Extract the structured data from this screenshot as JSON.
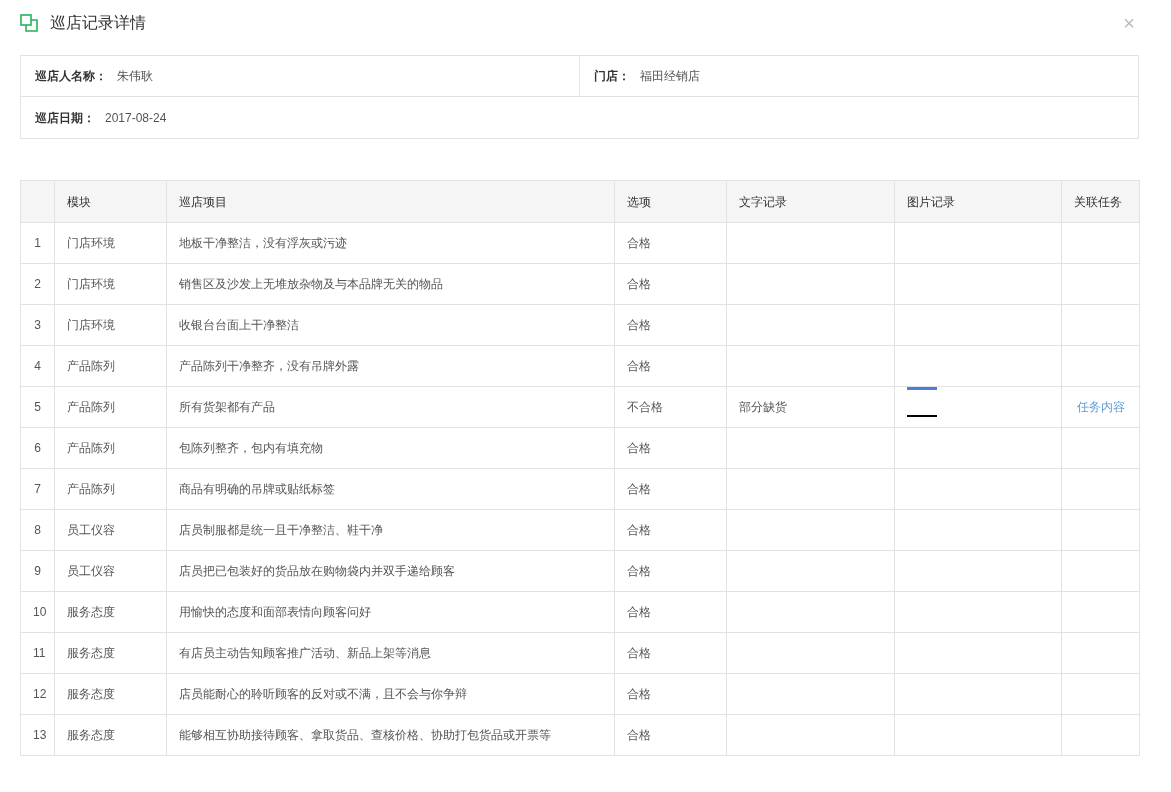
{
  "dialog": {
    "title": "巡店记录详情",
    "close": "×"
  },
  "info": [
    {
      "label": "巡店人名称：",
      "value": "朱伟耿"
    },
    {
      "label": "门店：",
      "value": "福田经销店"
    },
    {
      "label": "巡店日期：",
      "value": "2017-08-24"
    }
  ],
  "table": {
    "columns": [
      "",
      "模块",
      "巡店项目",
      "选项",
      "文字记录",
      "图片记录",
      "关联任务"
    ],
    "rows": [
      {
        "index": "1",
        "module": "门店环境",
        "item": "地板干净整洁，没有浮灰或污迹",
        "option": "合格",
        "photo": false
      },
      {
        "index": "2",
        "module": "门店环境",
        "item": "销售区及沙发上无堆放杂物及与本品牌无关的物品",
        "option": "合格",
        "photo": false
      },
      {
        "index": "3",
        "module": "门店环境",
        "item": "收银台台面上干净整洁",
        "option": "合格",
        "photo": false
      },
      {
        "index": "4",
        "module": "产品陈列",
        "item": "产品陈列干净整齐，没有吊牌外露",
        "option": "合格",
        "photo": false
      },
      {
        "index": "5",
        "module": "产品陈列",
        "item": "所有货架都有产品",
        "option": "不合格",
        "note": "部分缺货",
        "photo": true,
        "task": "任务内容"
      },
      {
        "index": "6",
        "module": "产品陈列",
        "item": "包陈列整齐，包内有填充物",
        "option": "合格",
        "photo": false
      },
      {
        "index": "7",
        "module": "产品陈列",
        "item": "商品有明确的吊牌或贴纸标签",
        "option": "合格",
        "photo": false
      },
      {
        "index": "8",
        "module": "员工仪容",
        "item": "店员制服都是统一且干净整洁、鞋干净",
        "option": "合格",
        "photo": false
      },
      {
        "index": "9",
        "module": "员工仪容",
        "item": "店员把已包装好的货品放在购物袋内并双手递给顾客",
        "option": "合格",
        "photo": false
      },
      {
        "index": "10",
        "module": "服务态度",
        "item": "用愉快的态度和面部表情向顾客问好",
        "option": "合格",
        "photo": false
      },
      {
        "index": "11",
        "module": "服务态度",
        "item": "有店员主动告知顾客推广活动、新品上架等消息",
        "option": "合格",
        "photo": false
      },
      {
        "index": "12",
        "module": "服务态度",
        "item": "店员能耐心的聆听顾客的反对或不满，且不会与你争辩",
        "option": "合格",
        "photo": false
      },
      {
        "index": "13",
        "module": "服务态度",
        "item": "能够相互协助接待顾客、拿取货品、查核价格、协助打包货品或开票等",
        "option": "合格",
        "photo": false
      }
    ]
  }
}
